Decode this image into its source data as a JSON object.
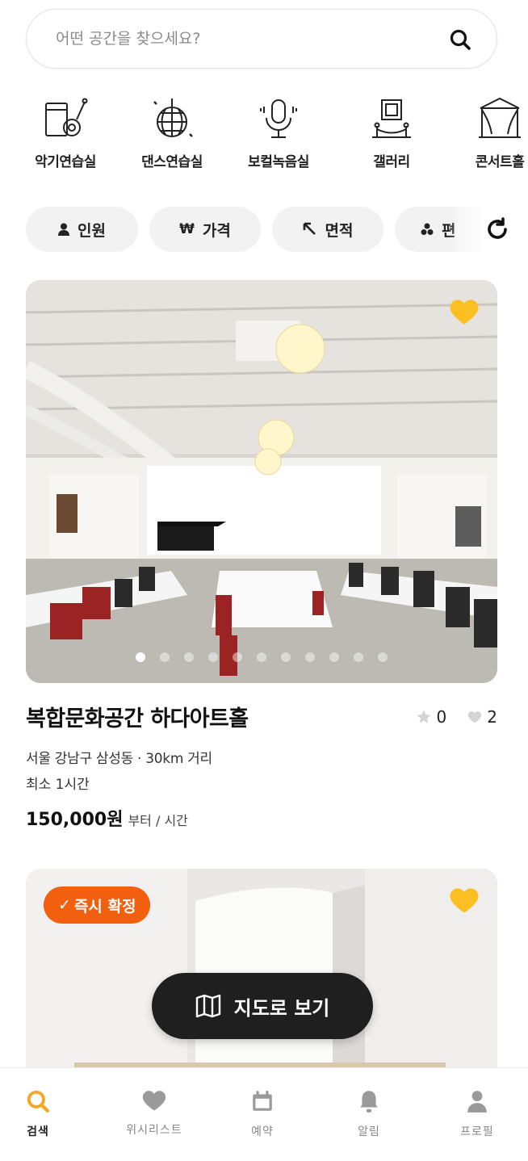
{
  "search": {
    "placeholder": "어떤 공간을 찾으세요?"
  },
  "categories": [
    {
      "label": "악기연습실",
      "icon": "instrument-icon"
    },
    {
      "label": "댄스연습실",
      "icon": "disco-ball-icon"
    },
    {
      "label": "보컬녹음실",
      "icon": "microphone-icon"
    },
    {
      "label": "갤러리",
      "icon": "gallery-frame-icon"
    },
    {
      "label": "콘서트홀",
      "icon": "concert-stage-icon"
    }
  ],
  "filters": [
    {
      "label": "인원",
      "icon": "person-icon"
    },
    {
      "label": "가격",
      "icon": "won-icon",
      "symbol": "₩"
    },
    {
      "label": "면적",
      "icon": "resize-arrow-icon"
    },
    {
      "label": "편",
      "icon": "amenities-icon"
    }
  ],
  "listings": [
    {
      "title": "복합문화공간 하다아트홀",
      "rating": "0",
      "likes": "2",
      "location": "서울 강남구 삼성동 · 30km 거리",
      "min_time": "최소 1시간",
      "price": "150,000원",
      "price_unit": "부터 / 시간",
      "favorited": true,
      "photo_count": 11,
      "current_photo": 1
    },
    {
      "badge": "즉시 확정",
      "favorited": true
    }
  ],
  "map_button": {
    "label": "지도로 보기"
  },
  "nav": [
    {
      "label": "검색",
      "active": true
    },
    {
      "label": "위시리스트"
    },
    {
      "label": "예약"
    },
    {
      "label": "알림"
    },
    {
      "label": "프로필"
    }
  ],
  "colors": {
    "accent": "#f5a623",
    "badge": "#f15f0f",
    "heart": "#fbbf24",
    "map_button": "#1f1f1f"
  }
}
